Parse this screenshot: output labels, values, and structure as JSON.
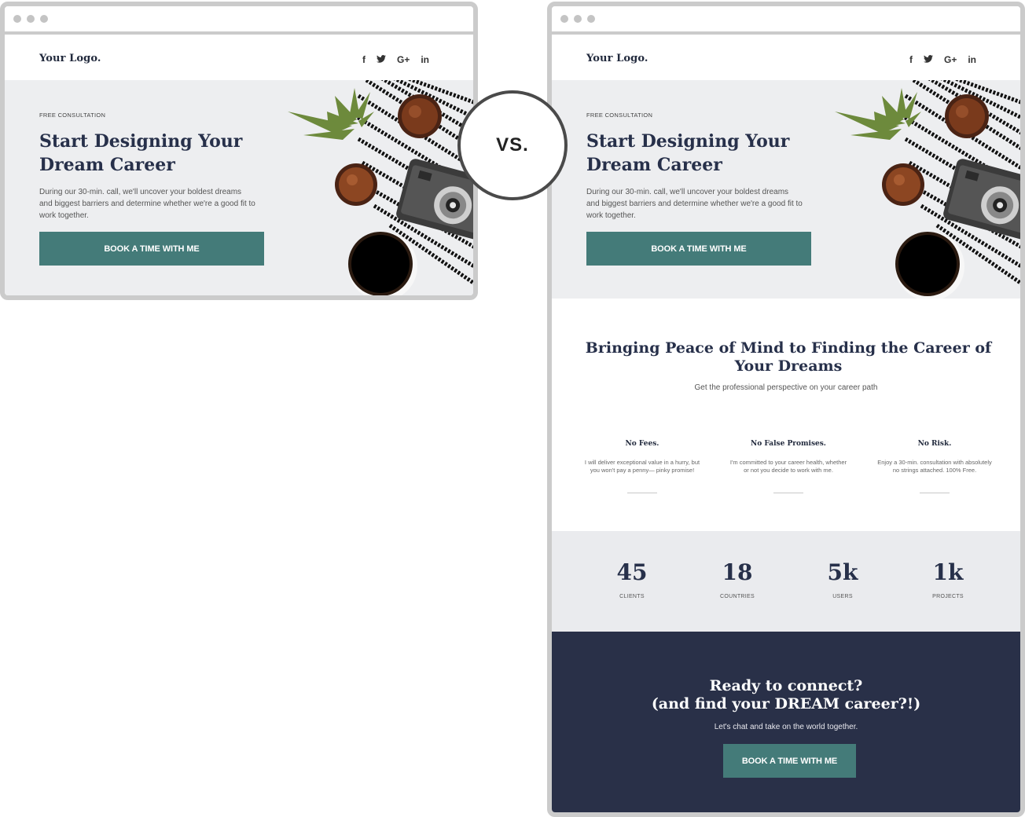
{
  "comparison_label": "VS.",
  "left_page": {
    "logo": "Your Logo.",
    "socials": [
      "f",
      "✓",
      "G+",
      "in"
    ],
    "hero": {
      "eyebrow": "FREE CONSULTATION",
      "title": "Start Designing Your Dream Career",
      "body": "During our 30-min. call, we'll uncover your boldest dreams and biggest barriers and determine whether we're a good fit to work together.",
      "cta": "BOOK A TIME WITH ME"
    }
  },
  "right_page": {
    "logo": "Your Logo.",
    "socials": [
      "f",
      "✓",
      "G+",
      "in"
    ],
    "hero": {
      "eyebrow": "FREE CONSULTATION",
      "title": "Start Designing Your Dream Career",
      "body": "During our 30-min. call, we'll uncover your boldest dreams and biggest barriers and determine whether we're a good fit to work together.",
      "cta": "BOOK A TIME WITH ME"
    },
    "intro": {
      "title": "Bringing Peace of Mind to Finding the Career of Your Dreams",
      "subtitle": "Get the professional perspective on your career path"
    },
    "features": [
      {
        "title": "No Fees.",
        "text": "I will deliver exceptional value in a hurry, but you won't pay a penny— pinky promise!"
      },
      {
        "title": "No False Promises.",
        "text": "I'm committed to your career health, whether or not you decide to work with me."
      },
      {
        "title": "No Risk.",
        "text": "Enjoy a 30-min. consultation with absolutely no strings attached. 100% Free."
      }
    ],
    "stats": [
      {
        "value": "45",
        "label": "CLIENTS"
      },
      {
        "value": "18",
        "label": "COUNTRIES"
      },
      {
        "value": "5k",
        "label": "USERS"
      },
      {
        "value": "1k",
        "label": "PROJECTS"
      }
    ],
    "cta_section": {
      "title_line1": "Ready to connect?",
      "title_line2": "(and find your DREAM career?!)",
      "subtitle": "Let's chat and take on the world together.",
      "button": "BOOK A TIME WITH ME"
    }
  },
  "colors": {
    "accent_teal": "#447b79",
    "navy": "#293048",
    "hero_bg": "#edeef0",
    "stats_bg": "#eaebee",
    "frame_gray": "#cbcbcb"
  }
}
